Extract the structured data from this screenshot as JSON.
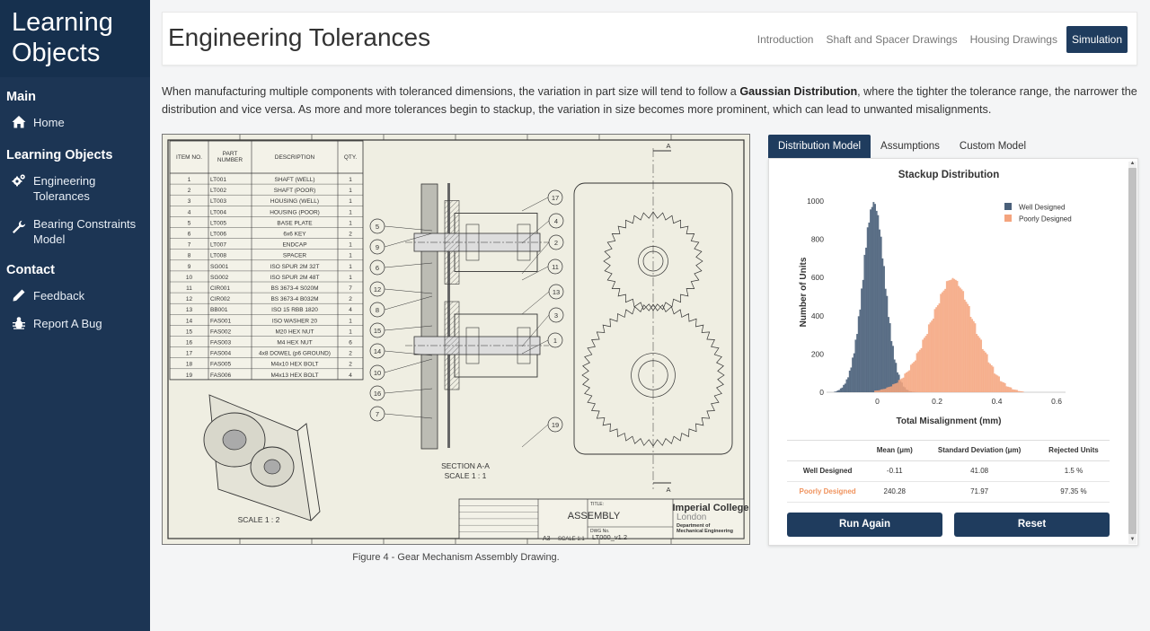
{
  "sidebar": {
    "brand": "Learning Objects",
    "sections": [
      {
        "title": "Main",
        "items": [
          {
            "label": "Home",
            "icon": "home-icon"
          }
        ]
      },
      {
        "title": "Learning Objects",
        "items": [
          {
            "label": "Engineering Tolerances",
            "icon": "cogs-icon"
          },
          {
            "label": "Bearing Constraints Model",
            "icon": "wrench-icon"
          }
        ]
      },
      {
        "title": "Contact",
        "items": [
          {
            "label": "Feedback",
            "icon": "pencil-icon"
          },
          {
            "label": "Report A Bug",
            "icon": "bug-icon"
          }
        ]
      }
    ]
  },
  "header": {
    "title": "Engineering Tolerances",
    "nav": [
      "Introduction",
      "Shaft and Spacer Drawings",
      "Housing Drawings",
      "Simulation"
    ],
    "active_nav": "Simulation"
  },
  "intro": {
    "part1": "When manufacturing multiple components with toleranced dimensions, the variation in part size will tend to follow a ",
    "bold": "Gaussian Distribution",
    "part2": ", where the tighter the tolerance range, the narrower the distribution and vice versa. As more and more tolerances begin to stackup, the variation in size becomes more prominent, which can lead to unwanted misalignments."
  },
  "drawing": {
    "caption": "Figure 4 - Gear Mechanism Assembly Drawing.",
    "bom_headers": [
      "ITEM NO.",
      "PART NUMBER",
      "DESCRIPTION",
      "QTY."
    ],
    "bom_rows": [
      [
        "1",
        "LT001",
        "SHAFT (WELL)",
        "1"
      ],
      [
        "2",
        "LT002",
        "SHAFT (POOR)",
        "1"
      ],
      [
        "3",
        "LT003",
        "HOUSING (WELL)",
        "1"
      ],
      [
        "4",
        "LT004",
        "HOUSING (POOR)",
        "1"
      ],
      [
        "5",
        "LT005",
        "BASE PLATE",
        "1"
      ],
      [
        "6",
        "LT006",
        "6x6 KEY",
        "2"
      ],
      [
        "7",
        "LT007",
        "ENDCAP",
        "1"
      ],
      [
        "8",
        "LT008",
        "SPACER",
        "1"
      ],
      [
        "9",
        "SG001",
        "ISO SPUR 2M 32T",
        "1"
      ],
      [
        "10",
        "SG002",
        "ISO SPUR 2M 48T",
        "1"
      ],
      [
        "11",
        "CIR001",
        "BS 3673-4 S020M",
        "7"
      ],
      [
        "12",
        "CIR002",
        "BS 3673-4 B032M",
        "2"
      ],
      [
        "13",
        "BB001",
        "ISO 15 RBB 1820",
        "4"
      ],
      [
        "14",
        "FAS001",
        "ISO WASHER 20",
        "1"
      ],
      [
        "15",
        "FAS002",
        "M20 HEX NUT",
        "1"
      ],
      [
        "16",
        "FAS003",
        "M4 HEX NUT",
        "6"
      ],
      [
        "17",
        "FAS004",
        "4x8 DOWEL (p6 GROUND)",
        "2"
      ],
      [
        "18",
        "FAS005",
        "M4x10 HEX BOLT",
        "2"
      ],
      [
        "19",
        "FAS006",
        "M4x13 HEX BOLT",
        "4"
      ]
    ],
    "section_label": "SECTION A-A",
    "section_scale": "SCALE 1 : 1",
    "iso_scale": "SCALE 1 : 2",
    "balloons": [
      "17",
      "4",
      "2",
      "11",
      "13",
      "3",
      "1",
      "19",
      "5",
      "9",
      "6",
      "12",
      "8",
      "15",
      "14",
      "10",
      "16",
      "7"
    ],
    "cut_label": "A",
    "title_block": {
      "title_label": "TITLE:",
      "title": "ASSEMBLY",
      "dwg_label": "DWG No.",
      "dwg": "LT000_v1.2",
      "size": "A3",
      "scale": "SCALE 1:1",
      "college": "Imperial College",
      "city": "London",
      "dept1": "Department of",
      "dept2": "Mechanical Engineering"
    }
  },
  "tabs": [
    "Distribution Model",
    "Assumptions",
    "Custom Model"
  ],
  "active_tab": "Distribution Model",
  "chart_data": {
    "type": "bar",
    "title": "Stackup Distribution",
    "xlabel": "Total Misalignment (mm)",
    "ylabel": "Number of Units",
    "xlim": [
      -0.17,
      0.63
    ],
    "ylim": [
      0,
      1000
    ],
    "xticks": [
      0,
      0.2,
      0.4,
      0.6
    ],
    "yticks": [
      0,
      200,
      400,
      600,
      800,
      1000
    ],
    "legend_position": "top-right",
    "series": [
      {
        "name": "Well Designed",
        "color": "#4a607a",
        "mean": -0.00011,
        "sd": 0.0411,
        "x": [
          -0.14,
          -0.13,
          -0.12,
          -0.11,
          -0.1,
          -0.09,
          -0.08,
          -0.07,
          -0.06,
          -0.05,
          -0.04,
          -0.03,
          -0.02,
          -0.01,
          0,
          0.01,
          0.02,
          0.03,
          0.04,
          0.05,
          0.06,
          0.07,
          0.08,
          0.09,
          0.1,
          0.11,
          0.12,
          0.13
        ],
        "values": [
          2,
          8,
          18,
          35,
          62,
          105,
          170,
          260,
          380,
          520,
          700,
          850,
          950,
          1000,
          960,
          870,
          720,
          560,
          410,
          280,
          180,
          110,
          62,
          32,
          15,
          6,
          3,
          1
        ]
      },
      {
        "name": "Poorly Designed",
        "color": "#f4a47e",
        "mean": 0.24028,
        "sd": 0.07197,
        "x": [
          0.0,
          0.02,
          0.04,
          0.06,
          0.08,
          0.1,
          0.12,
          0.14,
          0.16,
          0.18,
          0.2,
          0.22,
          0.24,
          0.26,
          0.28,
          0.3,
          0.32,
          0.34,
          0.36,
          0.38,
          0.4,
          0.42,
          0.44,
          0.46,
          0.48
        ],
        "values": [
          8,
          14,
          24,
          40,
          62,
          95,
          140,
          200,
          270,
          350,
          430,
          510,
          580,
          600,
          560,
          490,
          400,
          310,
          230,
          160,
          100,
          60,
          32,
          16,
          7
        ]
      }
    ]
  },
  "stats": {
    "headers": [
      "",
      "Mean (μm)",
      "Standard Deviation (μm)",
      "Rejected Units"
    ],
    "rows": [
      {
        "label": "Well Designed",
        "mean": "-0.11",
        "sd": "41.08",
        "rejected": "1.5 %",
        "color": "#333333"
      },
      {
        "label": "Poorly Designed",
        "mean": "240.28",
        "sd": "71.97",
        "rejected": "97.35 %",
        "color": "#f0935e"
      }
    ]
  },
  "buttons": {
    "run_again": "Run Again",
    "reset": "Reset"
  }
}
